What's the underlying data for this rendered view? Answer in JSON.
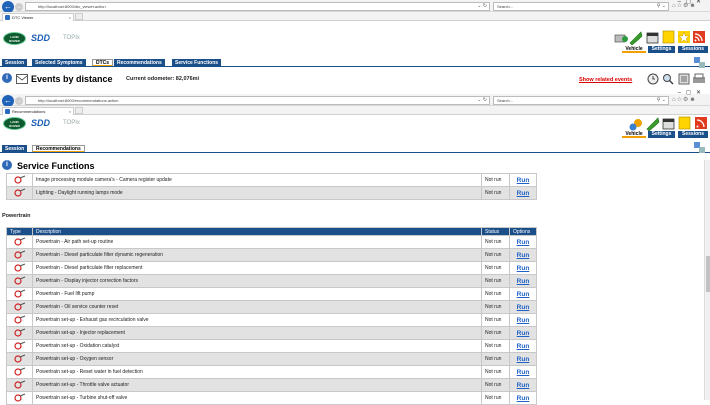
{
  "back_window": {
    "url": "http://localhost:8000/dtc_viewer.action",
    "tab_title": "DTC Viewer",
    "search_placeholder": "Search...",
    "logo_text_1": "LAND",
    "logo_text_2": "ROVER",
    "brand": "SDD",
    "topix": "TOPIx",
    "toolbar_labels": [
      "Vehicle",
      "Settings",
      "Sessions"
    ],
    "nav_tabs": [
      "Session",
      "Selected Symptoms",
      "DTCs",
      "Recommendations",
      "Service Functions"
    ],
    "active_tab": "DTCs",
    "title": "Events by distance",
    "odometer": "Current odometer: 82,076mi",
    "related_link": "Show related events"
  },
  "front_window": {
    "url": "http://localhost:8000/recommendations.action",
    "tab_title": "Recommendations",
    "search_placeholder": "Search...",
    "logo_text_1": "LAND",
    "logo_text_2": "ROVER",
    "brand": "SDD",
    "topix": "TOPIx",
    "toolbar_labels": [
      "Vehicle",
      "Settings",
      "Sessions"
    ],
    "nav_tabs": [
      "Session",
      "Recommendations"
    ],
    "active_tab": "Recommendations",
    "section_title": "Service Functions"
  },
  "top_table": {
    "rows": [
      {
        "description": "Image processing module camera's - Camera register update",
        "status": "Not run",
        "option": "Run"
      },
      {
        "description": "Lighting - Daylight running lamps mode",
        "status": "Not run",
        "option": "Run"
      }
    ]
  },
  "powertrain": {
    "group_label": "Powertrain",
    "headers": {
      "type": "Type",
      "description": "Description",
      "status": "Status",
      "options": "Options"
    },
    "rows": [
      {
        "description": "Powertrain - Air path set-up routine",
        "status": "Not run",
        "option": "Run"
      },
      {
        "description": "Powertrain - Diesel particulate filter dynamic regeneration",
        "status": "Not run",
        "option": "Run"
      },
      {
        "description": "Powertrain - Diesel particulate filter replacement",
        "status": "Not run",
        "option": "Run"
      },
      {
        "description": "Powertrain - Display injector correction factors",
        "status": "Not run",
        "option": "Run"
      },
      {
        "description": "Powertrain - Fuel lift pump",
        "status": "Not run",
        "option": "Run"
      },
      {
        "description": "Powertrain - Oil service counter reset",
        "status": "Not run",
        "option": "Run"
      },
      {
        "description": "Powertrain set-up - Exhaust gas recirculation valve",
        "status": "Not run",
        "option": "Run"
      },
      {
        "description": "Powertrain set-up - Injector replacement",
        "status": "Not run",
        "option": "Run"
      },
      {
        "description": "Powertrain set-up - Oxidation catalyst",
        "status": "Not run",
        "option": "Run"
      },
      {
        "description": "Powertrain set-up - Oxygen sensor",
        "status": "Not run",
        "option": "Run"
      },
      {
        "description": "Powertrain set-up - Reset water in fuel detection",
        "status": "Not run",
        "option": "Run"
      },
      {
        "description": "Powertrain set-up - Throttle valve actuator",
        "status": "Not run",
        "option": "Run"
      },
      {
        "description": "Powertrain set-up - Turbine shut-off valve",
        "status": "Not run",
        "option": "Run"
      }
    ]
  },
  "colors": {
    "nav_blue": "#1b4f8a",
    "run_link": "#1e62c8",
    "related_red": "#dd0000",
    "active_underline": "#f0a000"
  }
}
